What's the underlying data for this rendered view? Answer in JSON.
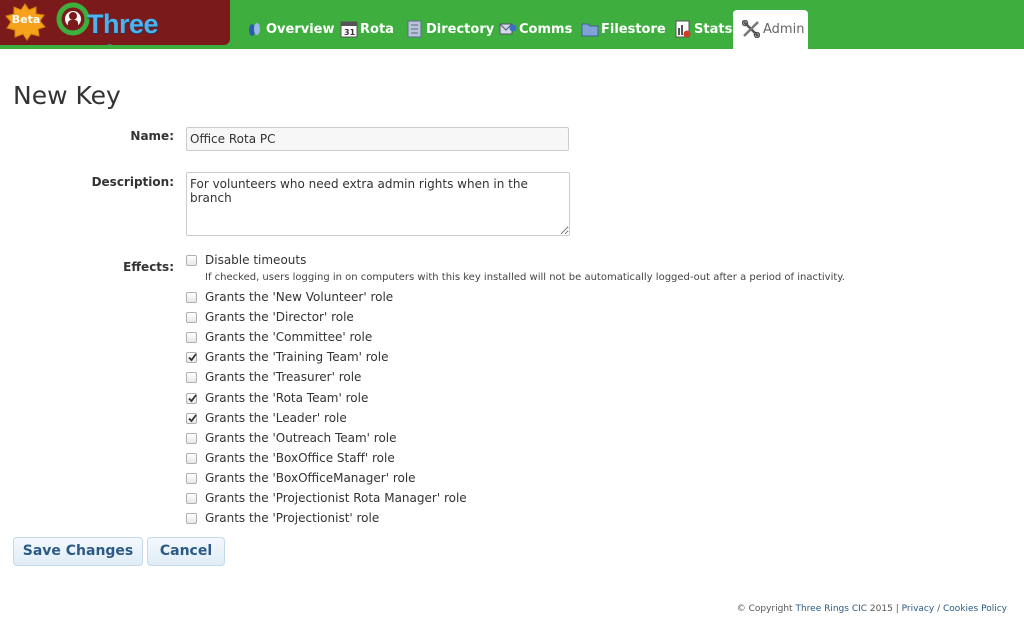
{
  "app": {
    "brand": "Three Rings",
    "beta_label": "Beta"
  },
  "nav": {
    "tabs": [
      {
        "label": "Overview",
        "icon": "overview-icon",
        "active": false
      },
      {
        "label": "Rota",
        "icon": "calendar-icon",
        "active": false
      },
      {
        "label": "Directory",
        "icon": "directory-icon",
        "active": false
      },
      {
        "label": "Comms",
        "icon": "comms-icon",
        "active": false
      },
      {
        "label": "Filestore",
        "icon": "folder-icon",
        "active": false
      },
      {
        "label": "Stats",
        "icon": "stats-icon",
        "active": false
      },
      {
        "label": "Admin",
        "icon": "tools-icon",
        "active": true
      }
    ]
  },
  "page": {
    "title": "New Key"
  },
  "form": {
    "name_label": "Name:",
    "name_value": "Office Rota PC",
    "description_label": "Description:",
    "description_value": "For volunteers who need extra admin rights when in the branch",
    "effects_label": "Effects:",
    "disable_timeouts": {
      "label": "Disable timeouts",
      "checked": false,
      "help": "If checked, users logging in on computers with this key installed will not be automatically logged-out after a period of inactivity."
    },
    "roles": [
      {
        "label": "Grants the 'New Volunteer' role",
        "checked": false
      },
      {
        "label": "Grants the 'Director' role",
        "checked": false
      },
      {
        "label": "Grants the 'Committee' role",
        "checked": false
      },
      {
        "label": "Grants the 'Training Team' role",
        "checked": true
      },
      {
        "label": "Grants the 'Treasurer' role",
        "checked": false
      },
      {
        "label": "Grants the 'Rota Team' role",
        "checked": true
      },
      {
        "label": "Grants the 'Leader' role",
        "checked": true
      },
      {
        "label": "Grants the 'Outreach Team' role",
        "checked": false
      },
      {
        "label": "Grants the 'BoxOffice Staff' role",
        "checked": false
      },
      {
        "label": "Grants the 'BoxOfficeManager' role",
        "checked": false
      },
      {
        "label": "Grants the 'Projectionist Rota Manager' role",
        "checked": false
      },
      {
        "label": "Grants the 'Projectionist' role",
        "checked": false
      }
    ],
    "save_label": "Save Changes",
    "cancel_label": "Cancel"
  },
  "footer": {
    "copyright_prefix": "© Copyright",
    "company": "Three Rings CIC",
    "year": "2015",
    "separator": "|",
    "privacy": "Privacy",
    "slash": "/",
    "cookies": "Cookies Policy"
  },
  "colors": {
    "topbar": "#3eaf3e",
    "logo_background": "#7a1a1a",
    "brand_text": "#4bb3f0",
    "button_text": "#2c5a86",
    "link": "#2c5a86"
  }
}
